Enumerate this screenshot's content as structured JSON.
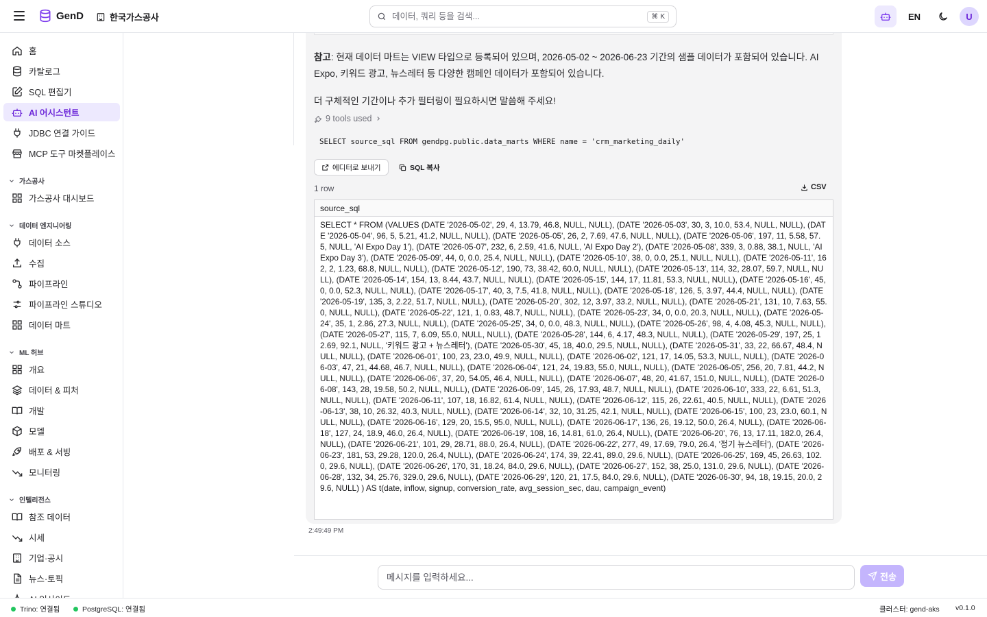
{
  "header": {
    "app_name": "GenD",
    "org_name": "한국가스공사",
    "search_placeholder": "데이터, 쿼리 등을 검색...",
    "search_shortcut": "⌘ K",
    "lang": "EN",
    "avatar_initial": "U"
  },
  "sidebar": {
    "top_items": [
      {
        "label": "홈",
        "icon": "home-icon"
      },
      {
        "label": "카탈로그",
        "icon": "database-icon"
      },
      {
        "label": "SQL 편집기",
        "icon": "edit-icon"
      },
      {
        "label": "AI 어시스턴트",
        "icon": "bot-icon",
        "active": true
      },
      {
        "label": "JDBC 연결 가이드",
        "icon": "plug-icon"
      },
      {
        "label": "MCP 도구 마켓플레이스",
        "icon": "store-icon"
      }
    ],
    "sections": [
      {
        "title": "가스공사",
        "items": [
          {
            "label": "가스공사 대시보드",
            "icon": "dashboard-icon"
          }
        ]
      },
      {
        "title": "데이터 엔지니어링",
        "items": [
          {
            "label": "데이터 소스",
            "icon": "plug-icon"
          },
          {
            "label": "수집",
            "icon": "upload-icon"
          },
          {
            "label": "파이프라인",
            "icon": "workflow-icon"
          },
          {
            "label": "파이프라인 스튜디오",
            "icon": "studio-icon"
          },
          {
            "label": "데이터 마트",
            "icon": "grid-icon"
          }
        ]
      },
      {
        "title": "ML 허브",
        "items": [
          {
            "label": "개요",
            "icon": "grid-icon"
          },
          {
            "label": "데이터 & 피처",
            "icon": "layers-icon"
          },
          {
            "label": "개발",
            "icon": "book-icon"
          },
          {
            "label": "모델",
            "icon": "box-icon"
          },
          {
            "label": "배포 & 서빙",
            "icon": "rocket-icon"
          },
          {
            "label": "모니터링",
            "icon": "trend-icon"
          }
        ]
      },
      {
        "title": "인텔리전스",
        "items": [
          {
            "label": "참조 데이터",
            "icon": "book-icon"
          },
          {
            "label": "시세",
            "icon": "trend-icon"
          },
          {
            "label": "기업·공시",
            "icon": "building-icon"
          },
          {
            "label": "뉴스·토픽",
            "icon": "file-icon"
          },
          {
            "label": "AI 인사이트",
            "icon": "sparkle-icon"
          }
        ]
      }
    ]
  },
  "message": {
    "note_label": "참고",
    "note_text": ": 현재 데이터 마트는 VIEW 타입으로 등록되어 있으며, 2026-05-02 ~ 2026-06-23 기간의 샘플 데이터가 포함되어 있습니다. AI Expo, 키워드 광고, 뉴스레터 등 다양한 캠페인 데이터가 포함되어 있습니다.",
    "followup": "더 구체적인 기간이나 추가 필터링이 필요하시면 말씀해 주세요!",
    "tools_used": "9 tools used",
    "sql": "SELECT source_sql FROM gendpg.public.data_marts WHERE name = 'crm_marketing_daily'",
    "send_to_editor": "에디터로 보내기",
    "copy_sql": "SQL 복사",
    "row_count": "1 row",
    "csv": "CSV",
    "column": "source_sql",
    "cell": "SELECT * FROM (VALUES (DATE '2026-05-02', 29, 4, 13.79, 46.8, NULL, NULL), (DATE '2026-05-03', 30, 3, 10.0, 53.4, NULL, NULL), (DATE '2026-05-04', 96, 5, 5.21, 41.2, NULL, NULL), (DATE '2026-05-05', 26, 2, 7.69, 47.6, NULL, NULL), (DATE '2026-05-06', 197, 11, 5.58, 57.5, NULL, 'AI Expo Day 1'), (DATE '2026-05-07', 232, 6, 2.59, 41.6, NULL, 'AI Expo Day 2'), (DATE '2026-05-08', 339, 3, 0.88, 38.1, NULL, 'AI Expo Day 3'), (DATE '2026-05-09', 44, 0, 0.0, 25.4, NULL, NULL), (DATE '2026-05-10', 38, 0, 0.0, 25.1, NULL, NULL), (DATE '2026-05-11', 162, 2, 1.23, 68.8, NULL, NULL), (DATE '2026-05-12', 190, 73, 38.42, 60.0, NULL, NULL), (DATE '2026-05-13', 114, 32, 28.07, 59.7, NULL, NULL), (DATE '2026-05-14', 154, 13, 8.44, 43.7, NULL, NULL), (DATE '2026-05-15', 144, 17, 11.81, 53.3, NULL, NULL), (DATE '2026-05-16', 45, 0, 0.0, 52.3, NULL, NULL), (DATE '2026-05-17', 40, 3, 7.5, 41.8, NULL, NULL), (DATE '2026-05-18', 126, 5, 3.97, 44.4, NULL, NULL), (DATE '2026-05-19', 135, 3, 2.22, 51.7, NULL, NULL), (DATE '2026-05-20', 302, 12, 3.97, 33.2, NULL, NULL), (DATE '2026-05-21', 131, 10, 7.63, 55.0, NULL, NULL), (DATE '2026-05-22', 121, 1, 0.83, 48.7, NULL, NULL), (DATE '2026-05-23', 34, 0, 0.0, 20.3, NULL, NULL), (DATE '2026-05-24', 35, 1, 2.86, 27.3, NULL, NULL), (DATE '2026-05-25', 34, 0, 0.0, 48.3, NULL, NULL), (DATE '2026-05-26', 98, 4, 4.08, 45.3, NULL, NULL), (DATE '2026-05-27', 115, 7, 6.09, 55.0, NULL, NULL), (DATE '2026-05-28', 144, 6, 4.17, 48.3, NULL, NULL), (DATE '2026-05-29', 197, 25, 12.69, 92.1, NULL, '키워드 광고 + 뉴스레터'), (DATE '2026-05-30', 45, 18, 40.0, 29.5, NULL, NULL), (DATE '2026-05-31', 33, 22, 66.67, 48.4, NULL, NULL), (DATE '2026-06-01', 100, 23, 23.0, 49.9, NULL, NULL), (DATE '2026-06-02', 121, 17, 14.05, 53.3, NULL, NULL), (DATE '2026-06-03', 47, 21, 44.68, 46.7, NULL, NULL), (DATE '2026-06-04', 121, 24, 19.83, 55.0, NULL, NULL), (DATE '2026-06-05', 256, 20, 7.81, 44.2, NULL, NULL), (DATE '2026-06-06', 37, 20, 54.05, 46.4, NULL, NULL), (DATE '2026-06-07', 48, 20, 41.67, 151.0, NULL, NULL), (DATE '2026-06-08', 143, 28, 19.58, 50.2, NULL, NULL), (DATE '2026-06-09', 145, 26, 17.93, 48.7, NULL, NULL), (DATE '2026-06-10', 333, 22, 6.61, 51.3, NULL, NULL), (DATE '2026-06-11', 107, 18, 16.82, 61.4, NULL, NULL), (DATE '2026-06-12', 115, 26, 22.61, 40.5, NULL, NULL), (DATE '2026-06-13', 38, 10, 26.32, 40.3, NULL, NULL), (DATE '2026-06-14', 32, 10, 31.25, 42.1, NULL, NULL), (DATE '2026-06-15', 100, 23, 23.0, 60.1, NULL, NULL), (DATE '2026-06-16', 129, 20, 15.5, 95.0, NULL, NULL), (DATE '2026-06-17', 136, 26, 19.12, 50.0, 26.4, NULL), (DATE '2026-06-18', 127, 24, 18.9, 46.0, 26.4, NULL), (DATE '2026-06-19', 108, 16, 14.81, 61.0, 26.4, NULL), (DATE '2026-06-20', 76, 13, 17.11, 182.0, 26.4, NULL), (DATE '2026-06-21', 101, 29, 28.71, 88.0, 26.4, NULL), (DATE '2026-06-22', 277, 49, 17.69, 79.0, 26.4, '정기 뉴스레터'), (DATE '2026-06-23', 181, 53, 29.28, 120.0, 26.4, NULL), (DATE '2026-06-24', 174, 39, 22.41, 89.0, 29.6, NULL), (DATE '2026-06-25', 169, 45, 26.63, 102.0, 29.6, NULL), (DATE '2026-06-26', 170, 31, 18.24, 84.0, 29.6, NULL), (DATE '2026-06-27', 152, 38, 25.0, 131.0, 29.6, NULL), (DATE '2026-06-28', 132, 34, 25.76, 329.0, 29.6, NULL), (DATE '2026-06-29', 120, 21, 17.5, 84.0, 29.6, NULL), (DATE '2026-06-30', 94, 18, 19.15, 20.0, 29.6, NULL) ) AS t(date, inflow, signup, conversion_rate, avg_session_sec, dau, campaign_event)",
    "timestamp": "2:49:49 PM"
  },
  "composer": {
    "placeholder": "메시지를 입력하세요...",
    "send_label": "전송"
  },
  "statusbar": {
    "trino": "Trino: 연결됨",
    "postgres": "PostgreSQL: 연결됨",
    "cluster": "클러스터: gend-aks",
    "version": "v0.1.0"
  },
  "colors": {
    "accent": "#6d28d9",
    "accent_bg": "#ede9fe",
    "ok": "#22c55e"
  }
}
